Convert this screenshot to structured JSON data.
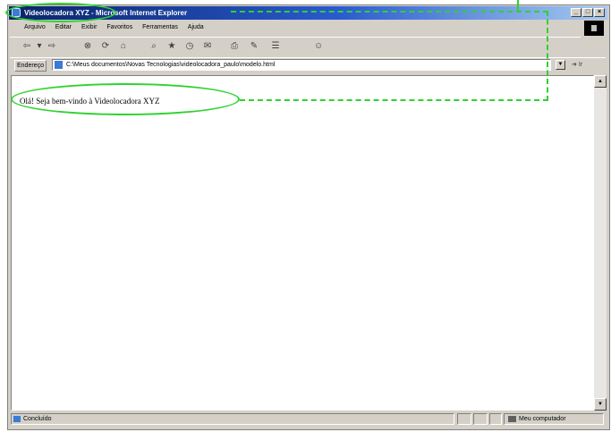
{
  "window": {
    "title": "Videolocadora XYZ - Microsoft Internet Explorer",
    "controls": [
      "_",
      "□",
      "×"
    ]
  },
  "menu": [
    "Arquivo",
    "Editar",
    "Exibir",
    "Favoritos",
    "Ferramentas",
    "Ajuda"
  ],
  "toolbar": {
    "buttons": [
      {
        "icon": "back-icon",
        "glyph": "⇦"
      },
      {
        "icon": "dropdown-icon",
        "glyph": "▾"
      },
      {
        "icon": "forward-icon",
        "glyph": "⇨"
      },
      {
        "icon": "stop-icon",
        "glyph": "⊗"
      },
      {
        "icon": "refresh-icon",
        "glyph": "⟳"
      },
      {
        "icon": "home-icon",
        "glyph": "⌂"
      },
      {
        "icon": "search-icon",
        "glyph": "⌕"
      },
      {
        "icon": "favorites-icon",
        "glyph": "★"
      },
      {
        "icon": "history-icon",
        "glyph": "◷"
      },
      {
        "icon": "mail-icon",
        "glyph": "✉"
      },
      {
        "icon": "print-icon",
        "glyph": "⎙"
      },
      {
        "icon": "edit-icon",
        "glyph": "✎"
      },
      {
        "icon": "discuss-icon",
        "glyph": "☰"
      },
      {
        "icon": "messenger-icon",
        "glyph": "☺"
      }
    ]
  },
  "address": {
    "label": "Endereço",
    "url": "C:\\Meus documentos\\Novas Tecnologias\\videolocadora_paulo\\modelo.html",
    "go_label": "Ir"
  },
  "page": {
    "text": "Olá! Seja bem-vindo à Videolocadora XYZ"
  },
  "status": {
    "text": "Concluído",
    "zone": "Meu computador"
  },
  "colors": {
    "annotation": "#2fd22f",
    "titlebar_start": "#0a246a",
    "titlebar_end": "#a6caf0"
  }
}
